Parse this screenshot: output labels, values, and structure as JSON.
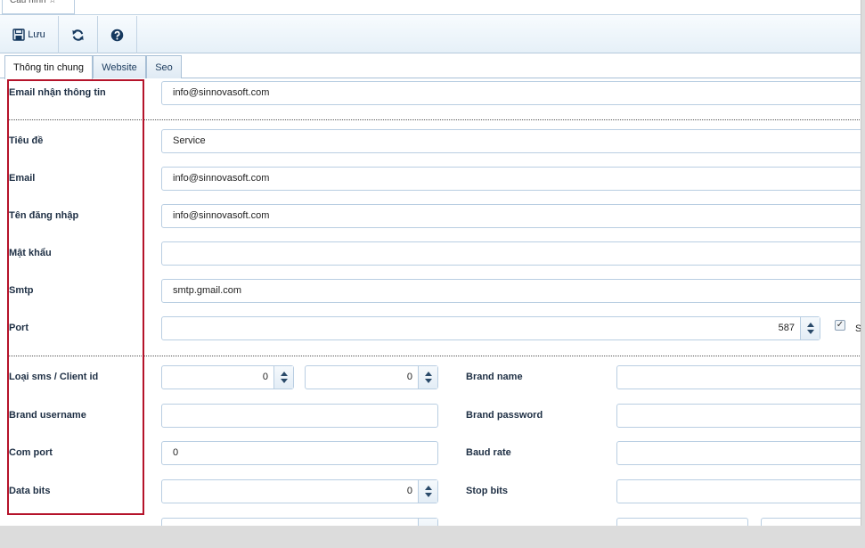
{
  "doc_tab": {
    "label": "Cấu hình ☆"
  },
  "toolbar": {
    "save_label": "Lưu"
  },
  "tabs": [
    {
      "label": "Thông tin chung"
    },
    {
      "label": "Website"
    },
    {
      "label": "Seo"
    }
  ],
  "form": {
    "email_receive": {
      "label": "Email nhận thông tin",
      "value": "info@sinnovasoft.com"
    },
    "title": {
      "label": "Tiêu đề",
      "value": "Service"
    },
    "email": {
      "label": "Email",
      "value": "info@sinnovasoft.com"
    },
    "username": {
      "label": "Tên đăng nhập",
      "value": "info@sinnovasoft.com"
    },
    "password": {
      "label": "Mật khẩu",
      "value": ""
    },
    "smtp": {
      "label": "Smtp",
      "value": "smtp.gmail.com"
    },
    "port": {
      "label": "Port",
      "value": "587",
      "ssl_checked": true,
      "ssl_label": "S"
    },
    "sms_type": {
      "label": "Loại sms / Client id",
      "value1": "0",
      "value2": "0"
    },
    "brand_name": {
      "label": "Brand name",
      "value": ""
    },
    "brand_username": {
      "label": "Brand username",
      "value": ""
    },
    "brand_password": {
      "label": "Brand password",
      "value": ""
    },
    "com_port": {
      "label": "Com port",
      "value": "0"
    },
    "baud_rate": {
      "label": "Baud rate",
      "value": ""
    },
    "data_bits": {
      "label": "Data bits",
      "value": "0"
    },
    "stop_bits": {
      "label": "Stop bits",
      "value": ""
    }
  },
  "colors": {
    "highlight_border": "#b5132a",
    "tab_border": "#a9c0d6"
  }
}
